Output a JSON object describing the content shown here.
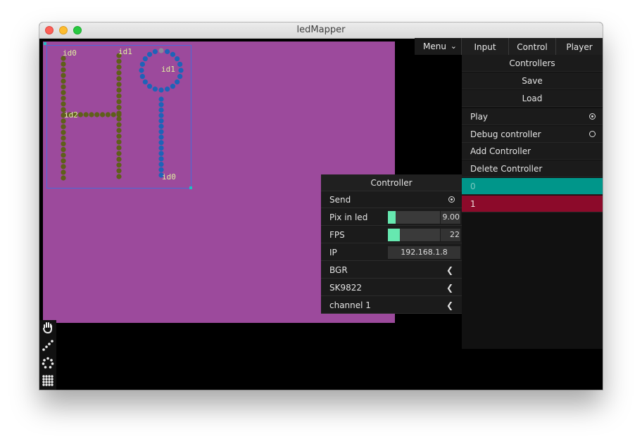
{
  "window": {
    "title": "ledMapper"
  },
  "canvas": {
    "labels": {
      "id0_left": "id0",
      "id1_top": "id1",
      "id1_circle": "id1",
      "id2": "id2",
      "id0_bottom": "id0"
    },
    "colors": {
      "background": "#9c4a9c",
      "strip_olive": "#5f5f1a",
      "strip_blue": "#1e63b8",
      "selection": "#4a6ad8",
      "label": "#e0f0a0"
    }
  },
  "toolbar": {
    "tools": [
      "hand-icon",
      "line-strip-icon",
      "circle-strip-icon",
      "grid-strip-icon"
    ]
  },
  "topbar": {
    "menu_label": "Menu",
    "tabs": [
      "Input",
      "Control",
      "Player"
    ]
  },
  "controllers_panel": {
    "header": "Controllers",
    "save_label": "Save",
    "load_label": "Load",
    "play_label": "Play",
    "play_on": true,
    "debug_label": "Debug controller",
    "debug_on": false,
    "add_label": "Add Controller",
    "delete_label": "Delete Controller",
    "items": [
      {
        "label": "0",
        "color": "#00968a"
      },
      {
        "label": "1",
        "color": "#8c0a2a"
      }
    ]
  },
  "controller_panel": {
    "title": "Controller",
    "send_label": "Send",
    "send_on": true,
    "pix_in_led_label": "Pix in led",
    "pix_in_led_value": "9.00",
    "pix_in_led_fraction": 0.15,
    "fps_label": "FPS",
    "fps_value": "22",
    "fps_fraction": 0.23,
    "ip_label": "IP",
    "ip_value": "192.168.1.8",
    "color_order": "BGR",
    "led_type": "SK9822",
    "channel": "channel 1"
  }
}
